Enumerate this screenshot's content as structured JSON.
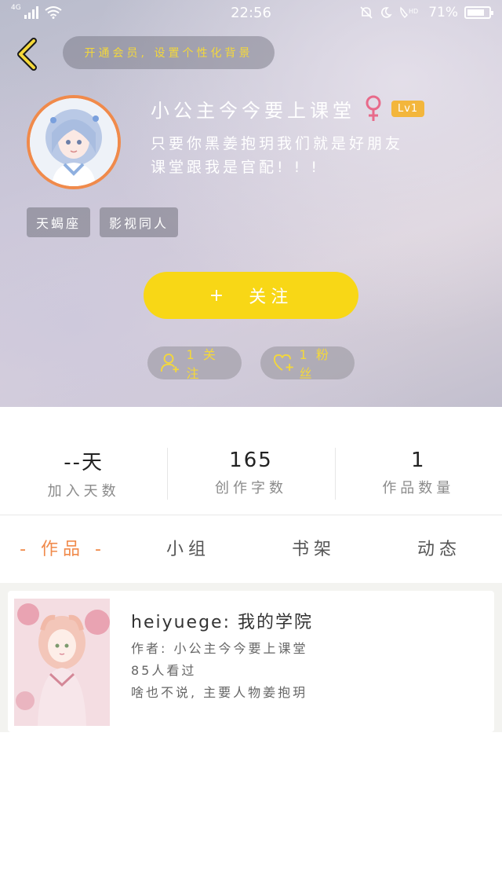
{
  "status_bar": {
    "network": "4G",
    "time": "22:56",
    "battery_percent": "71%",
    "battery_level": 0.71
  },
  "header": {
    "vip_prompt": "开通会员, 设置个性化背景",
    "nickname": "小公主今今要上课堂",
    "gender_symbol": "♀",
    "level": "Lv1",
    "bio_line1": "只要你黑姜抱玥我们就是好朋友",
    "bio_line2": "课堂跟我是官配! ! !",
    "tags": [
      "天蝎座",
      "影视同人"
    ],
    "follow_label": "关注",
    "follow_plus": "+",
    "following_text": "1 关注",
    "fans_text": "1 粉丝"
  },
  "stats": [
    {
      "value": "--天",
      "label": "加入天数"
    },
    {
      "value": "165",
      "label": "创作字数"
    },
    {
      "value": "1",
      "label": "作品数量"
    }
  ],
  "tabs": [
    {
      "label": "- 作品 -",
      "active": true
    },
    {
      "label": "小组",
      "active": false
    },
    {
      "label": "书架",
      "active": false
    },
    {
      "label": "动态",
      "active": false
    }
  ],
  "works": [
    {
      "title": "heiyuege: 我的学院",
      "author": "作者: 小公主今今要上课堂",
      "views": "85人看过",
      "summary": "啥也不说, 主要人物姜抱玥"
    }
  ],
  "colors": {
    "accent_yellow": "#f8d716",
    "accent_orange": "#f08a4b",
    "gold_text": "#f4d83a",
    "female_pink": "#e86a8a"
  }
}
